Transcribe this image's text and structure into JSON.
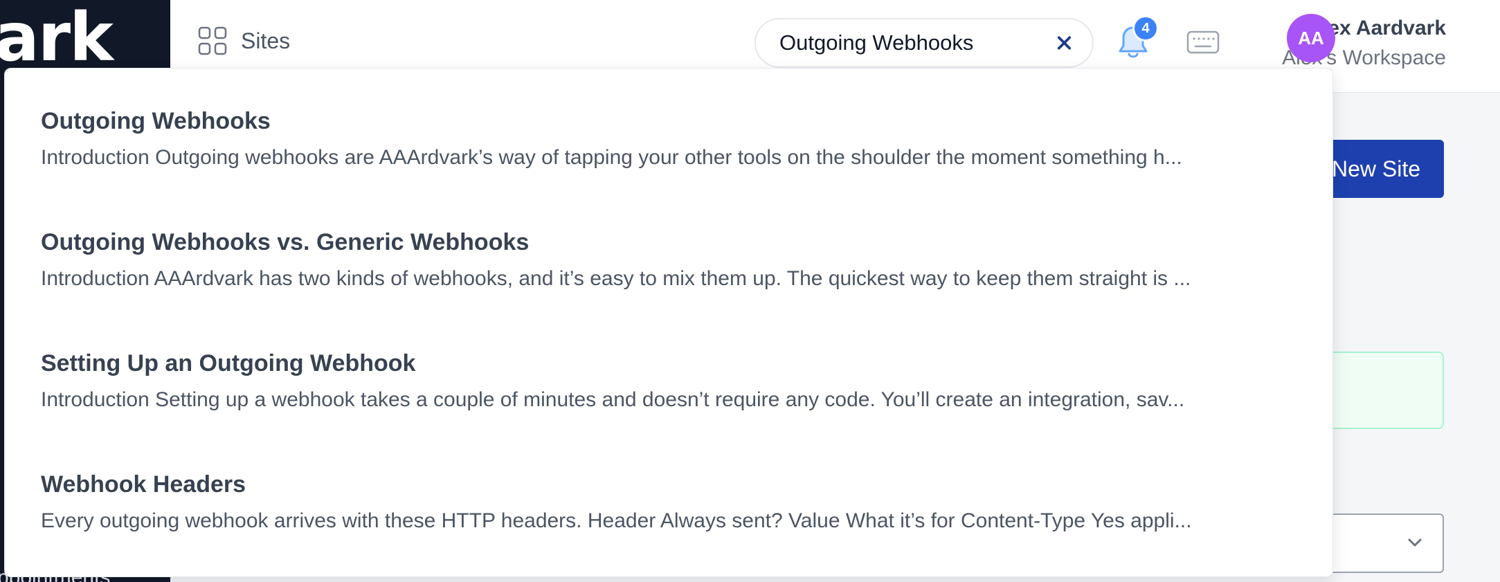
{
  "sidebar": {
    "logo_text": "ark",
    "cut_item_label": "ppointments"
  },
  "header": {
    "sites_label": "Sites",
    "search": {
      "value": "Outgoing Webhooks"
    },
    "notifications": {
      "count": "4"
    },
    "user": {
      "name": "Alex Aardvark",
      "workspace": "Alex's Workspace",
      "initials": "AA",
      "avatar_color": "#a855f7"
    }
  },
  "page": {
    "new_site_label": "New Site"
  },
  "search_results": [
    {
      "title": "Outgoing Webhooks",
      "snippet": "Introduction Outgoing webhooks are AAArdvark’s way of tapping your other tools on the shoulder the moment something h..."
    },
    {
      "title": "Outgoing Webhooks vs. Generic Webhooks",
      "snippet": "Introduction AAArdvark has two kinds of webhooks, and it’s easy to mix them up. The quickest way to keep them straight is ..."
    },
    {
      "title": "Setting Up an Outgoing Webhook",
      "snippet": "Introduction Setting up a webhook takes a couple of minutes and doesn’t require any code. You’ll create an integration, sav..."
    },
    {
      "title": "Webhook Headers",
      "snippet": "Every outgoing webhook arrives with these HTTP headers. Header Always sent? Value What it’s for Content-Type Yes appli..."
    }
  ],
  "colors": {
    "sidebar_bg": "#111827",
    "primary_button": "#1e40af",
    "badge": "#3b82f6",
    "clear_icon": "#1e3a8a"
  }
}
